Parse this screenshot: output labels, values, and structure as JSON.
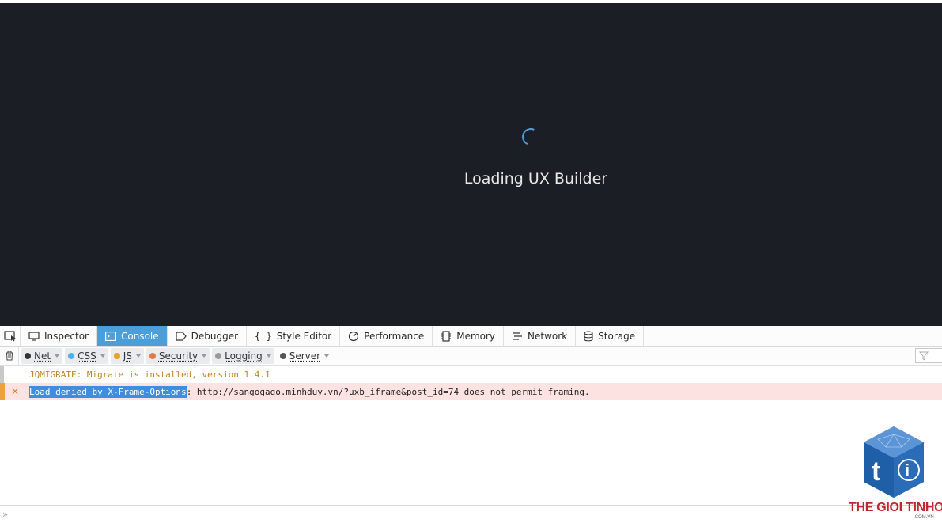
{
  "viewport": {
    "loading_text": "Loading UX Builder"
  },
  "toolbar": {
    "tabs": [
      {
        "label": "Inspector",
        "icon": "inspector-icon"
      },
      {
        "label": "Console",
        "icon": "console-icon",
        "active": true
      },
      {
        "label": "Debugger",
        "icon": "debugger-icon"
      },
      {
        "label": "Style Editor",
        "icon": "braces-icon"
      },
      {
        "label": "Performance",
        "icon": "performance-icon"
      },
      {
        "label": "Memory",
        "icon": "memory-icon"
      },
      {
        "label": "Network",
        "icon": "network-icon"
      },
      {
        "label": "Storage",
        "icon": "storage-icon"
      }
    ]
  },
  "filters": [
    {
      "label": "Net",
      "color": "#333333"
    },
    {
      "label": "CSS",
      "color": "#4ab3e8"
    },
    {
      "label": "JS",
      "color": "#e8a321"
    },
    {
      "label": "Security",
      "color": "#e07a4a"
    },
    {
      "label": "Logging",
      "color": "#9a9a9a"
    },
    {
      "label": "Server",
      "color": "#555555"
    }
  ],
  "console": {
    "messages": [
      {
        "type": "warning",
        "text": "JQMIGRATE: Migrate is installed, version 1.4.1"
      },
      {
        "type": "error",
        "highlight": "Load denied by X-Frame-Options",
        "rest": ": http://sangogago.minhduy.vn/?uxb_iframe&post_id=74 does not permit framing.",
        "icon": "x-mark-icon"
      }
    ]
  },
  "input": {
    "prompt": "»"
  },
  "watermark": {
    "brand": "THE GIOI TINHOC",
    "sub": ".COM.VN",
    "colors": {
      "primary": "#1f5fa8",
      "text": "#c4262e"
    }
  }
}
